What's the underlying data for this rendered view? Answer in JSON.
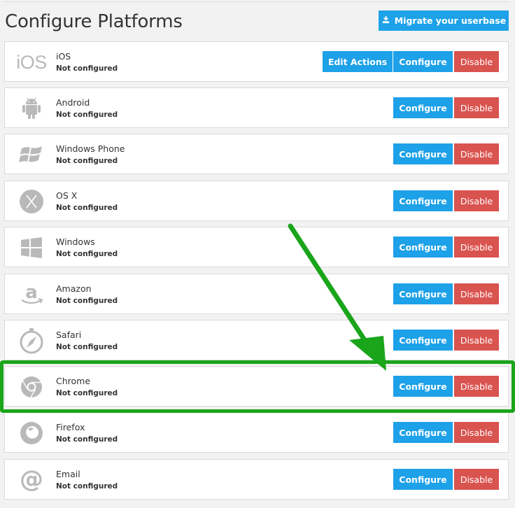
{
  "page": {
    "title": "Configure Platforms",
    "migrate_label": "Migrate your userbase"
  },
  "buttons": {
    "edit_actions": "Edit Actions",
    "configure": "Configure",
    "disable": "Disable"
  },
  "platforms": [
    {
      "name": "iOS",
      "status": "Not configured",
      "icon": "ios-icon",
      "icon_text": "iOS"
    },
    {
      "name": "Android",
      "status": "Not configured",
      "icon": "android-icon"
    },
    {
      "name": "Windows Phone",
      "status": "Not configured",
      "icon": "windows-phone-icon"
    },
    {
      "name": "OS X",
      "status": "Not configured",
      "icon": "osx-icon"
    },
    {
      "name": "Windows",
      "status": "Not configured",
      "icon": "windows-icon"
    },
    {
      "name": "Amazon",
      "status": "Not configured",
      "icon": "amazon-icon"
    },
    {
      "name": "Safari",
      "status": "Not configured",
      "icon": "safari-icon"
    },
    {
      "name": "Chrome",
      "status": "Not configured",
      "icon": "chrome-icon"
    },
    {
      "name": "Firefox",
      "status": "Not configured",
      "icon": "firefox-icon"
    },
    {
      "name": "Email",
      "status": "Not configured",
      "icon": "email-icon"
    }
  ],
  "colors": {
    "accent": "#1da1e8",
    "danger": "#d9534f",
    "highlight": "#1aa51a",
    "icon_gray": "#b9b9b9"
  }
}
